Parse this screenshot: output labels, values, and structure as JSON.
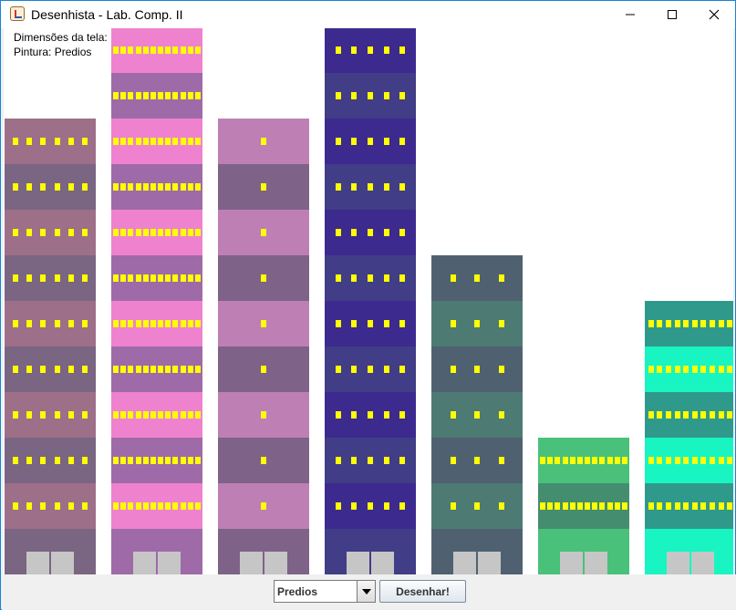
{
  "window": {
    "title": "Desenhista - Lab. Comp. II",
    "icon": "java-cup-icon",
    "controls": [
      "minimize-icon",
      "maximize-icon",
      "close-icon"
    ]
  },
  "canvas": {
    "dimension_label": "Dimensões da tela:",
    "paint_label": "Pintura: Predios"
  },
  "buildings": [
    {
      "floors": 9,
      "windows_per_floor": 6,
      "colors": [
        "#9e6f88",
        "#7a6582"
      ]
    },
    {
      "floors": 11,
      "windows_per_floor": 12,
      "colors": [
        "#ef82cf",
        "#9f6aa8"
      ]
    },
    {
      "floors": 9,
      "windows_per_floor": 1,
      "colors": [
        "#be7fb5",
        "#7f6288"
      ]
    },
    {
      "floors": 11,
      "windows_per_floor": 5,
      "colors": [
        "#3c2a8f",
        "#413d86"
      ]
    },
    {
      "floors": 6,
      "windows_per_floor": 3,
      "colors": [
        "#4f6171",
        "#4d7a73"
      ]
    },
    {
      "floors": 2,
      "windows_per_floor": 12,
      "colors": [
        "#49c17a",
        "#448d6f"
      ]
    },
    {
      "floors": 5,
      "windows_per_floor": 10,
      "colors": [
        "#2f9a8c",
        "#18f5c2"
      ]
    }
  ],
  "controls": {
    "selected": "Predios",
    "draw_label": "Desenhar!"
  }
}
